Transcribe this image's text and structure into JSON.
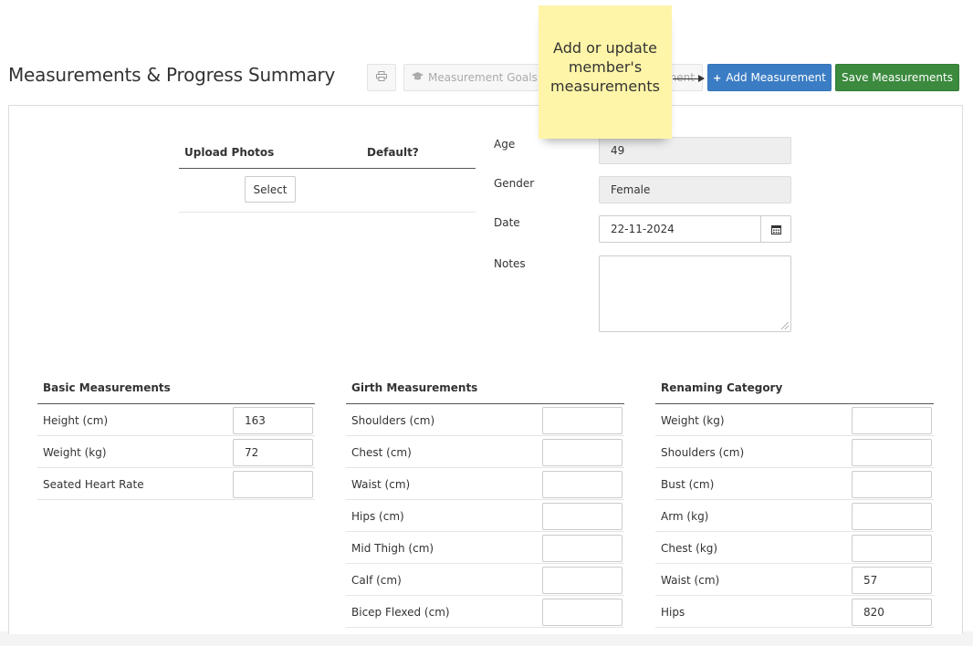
{
  "header": {
    "title": "Measurements & Progress Summary",
    "print_icon": "printer-icon",
    "goals_label": "Measurement Goals",
    "goals_icon": "graduation-cap-icon",
    "hidden_label": "ment",
    "add_label": "Add Measurement",
    "add_icon": "plus-icon",
    "save_label": "Save Measurements"
  },
  "tooltip": {
    "text": "Add or update member's measurements"
  },
  "photos": {
    "col_upload": "Upload Photos",
    "col_default": "Default?",
    "select_label": "Select"
  },
  "form": {
    "age_label": "Age",
    "age_value": "49",
    "gender_label": "Gender",
    "gender_value": "Female",
    "date_label": "Date",
    "date_value": "22-11-2024",
    "calendar_icon": "calendar-icon",
    "notes_label": "Notes",
    "notes_value": ""
  },
  "basic": {
    "title": "Basic Measurements",
    "rows": [
      {
        "label": "Height (cm)",
        "value": "163"
      },
      {
        "label": "Weight (kg)",
        "value": "72"
      },
      {
        "label": "Seated Heart Rate",
        "value": ""
      }
    ]
  },
  "girth": {
    "title": "Girth Measurements",
    "rows": [
      {
        "label": "Shoulders (cm)",
        "value": ""
      },
      {
        "label": "Chest (cm)",
        "value": ""
      },
      {
        "label": "Waist (cm)",
        "value": ""
      },
      {
        "label": "Hips (cm)",
        "value": ""
      },
      {
        "label": "Mid Thigh (cm)",
        "value": ""
      },
      {
        "label": "Calf (cm)",
        "value": ""
      },
      {
        "label": "Bicep Flexed (cm)",
        "value": ""
      }
    ]
  },
  "renaming": {
    "title": "Renaming Category",
    "rows": [
      {
        "label": "Weight (kg)",
        "value": ""
      },
      {
        "label": "Shoulders (cm)",
        "value": ""
      },
      {
        "label": "Bust (cm)",
        "value": ""
      },
      {
        "label": "Arm (kg)",
        "value": ""
      },
      {
        "label": "Chest (kg)",
        "value": ""
      },
      {
        "label": "Waist (cm)",
        "value": "57"
      },
      {
        "label": "Hips",
        "value": "820"
      }
    ]
  },
  "colors": {
    "primary": "#3b7dc4",
    "success": "#3b8a3e",
    "sticky_note": "#fff5a8"
  }
}
